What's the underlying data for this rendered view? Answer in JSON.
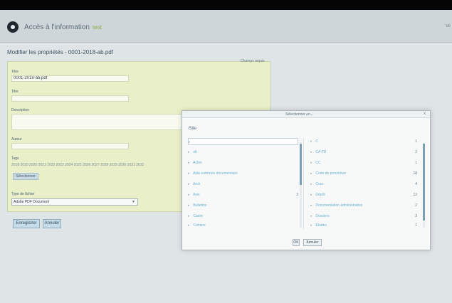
{
  "header": {
    "title": "Accès à l'information",
    "tag": "test",
    "corner": "Ve"
  },
  "page": {
    "title": "Modifier les propriétés - 0001-2018-ab.pdf"
  },
  "form": {
    "panel_link": "Champs requis",
    "title_label": "Titre",
    "title_value": "0001-2018-ab.pdf",
    "name_label": "Titre",
    "description_label": "Description",
    "author_label": "Auteur",
    "tags_label": "Tags",
    "tags_text": "2018 2019 2020 2021 2022 2023 2024 2025 2026 2027 2028 2029 2030 2031 2032",
    "select_button": "Sélectionner",
    "type_label": "Type de fichier",
    "type_value": "Adobe PDF Document",
    "save_button": "Enregistrer",
    "cancel_button": "Annuler"
  },
  "dialog": {
    "title": "Sélectionner un...",
    "close": "x",
    "path_prefix": "/",
    "path_current": "Site",
    "left_items": [
      {
        "label": ""
      },
      {
        "label": "ab"
      },
      {
        "label": "Actes"
      },
      {
        "label": "Aide-mémoire documentaire"
      },
      {
        "label": "Arch"
      },
      {
        "label": "Avis"
      },
      {
        "label": "Bulletins"
      },
      {
        "label": "Cadre"
      },
      {
        "label": "Cahiers"
      }
    ],
    "left_counts": [
      "",
      "",
      "",
      "",
      "",
      "3",
      "",
      "",
      ""
    ],
    "right_items": [
      {
        "label": "C",
        "count": "1"
      },
      {
        "label": "CA-TB",
        "count": "2"
      },
      {
        "label": "CC",
        "count": "1"
      },
      {
        "label": "Code de procédure",
        "count": "18"
      },
      {
        "label": "Cour",
        "count": "4"
      },
      {
        "label": "Dépôt",
        "count": "12"
      },
      {
        "label": "Documentation administrative",
        "count": "2"
      },
      {
        "label": "Dossiers",
        "count": "3"
      },
      {
        "label": "Études",
        "count": "1"
      }
    ],
    "ok_button": "OK",
    "cancel_button": "Annuler"
  }
}
